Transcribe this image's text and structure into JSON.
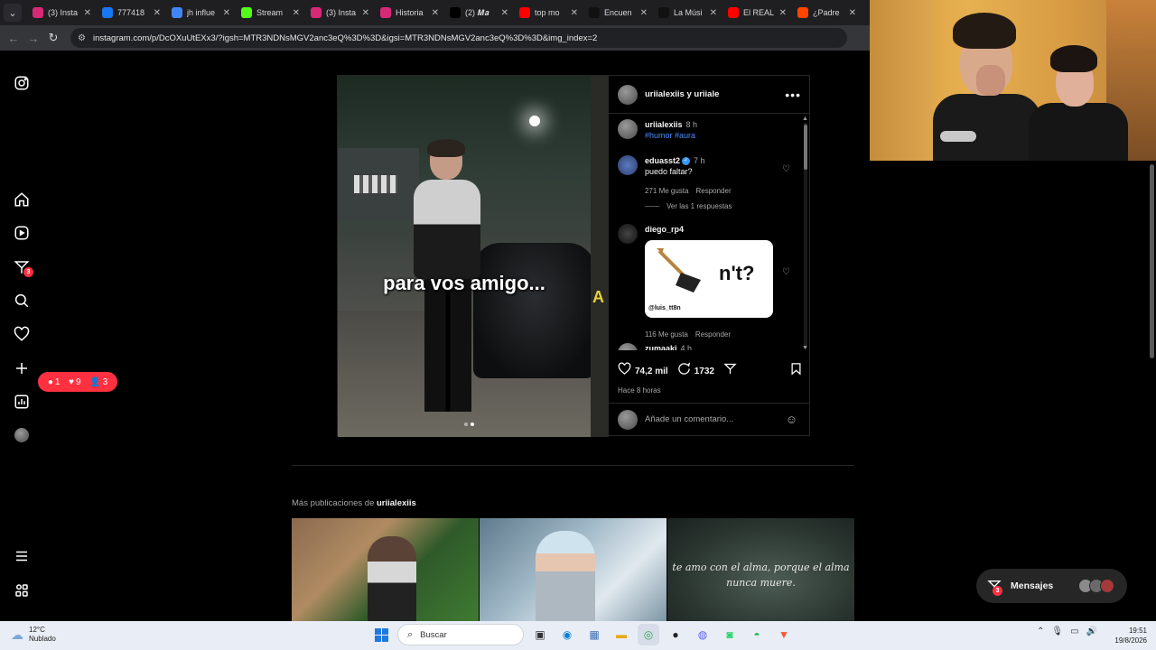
{
  "browser": {
    "tabs": [
      {
        "label": "(3) Insta",
        "icon": "instagram-icon",
        "color": "#d62976"
      },
      {
        "label": "777418",
        "icon": "facebook-icon",
        "color": "#1877f2"
      },
      {
        "label": "jh influe",
        "icon": "google-icon",
        "color": "#4285f4"
      },
      {
        "label": "Stream",
        "icon": "kick-icon",
        "color": "#53fc18"
      },
      {
        "label": "(3) Insta",
        "icon": "instagram-icon",
        "color": "#d62976"
      },
      {
        "label": "Historia",
        "icon": "instagram-icon",
        "color": "#d62976"
      },
      {
        "label": "(2) 𝑴𝒂",
        "icon": "x-icon",
        "color": "#000000"
      },
      {
        "label": "top mo",
        "icon": "youtube-icon",
        "color": "#ff0000"
      },
      {
        "label": "Encuen",
        "icon": "tiktok-icon",
        "color": "#111111"
      },
      {
        "label": "La Músi",
        "icon": "tiktok-icon",
        "color": "#111111"
      },
      {
        "label": "El REAL",
        "icon": "youtube-icon",
        "color": "#ff0000"
      },
      {
        "label": "¿Padre",
        "icon": "reddit-icon",
        "color": "#ff4500"
      }
    ],
    "url": "instagram.com/p/DcOXuUtEXx3/?igsh=MTR3NDNsMGV2anc3eQ%3D%3D&igsi=MTR3NDNsMGV2anc3eQ%3D%3D&img_index=2"
  },
  "nav": {
    "messages_badge": "3",
    "notifications": {
      "comments": "1",
      "likes": "9",
      "follows": "3"
    }
  },
  "post": {
    "header_name": "uriialexiis y uriiale",
    "overlay_text": "para vos amigo...",
    "next_slide_text": "A",
    "caption": {
      "user": "uriialexiis",
      "time": "8 h",
      "tags": "#humor #aura"
    },
    "comments": [
      {
        "user": "eduasst2",
        "time": "7 h",
        "text": "puedo faltar?",
        "likes": "271 Me gusta",
        "reply": "Responder",
        "view_replies": "Ver las 1 respuestas"
      },
      {
        "user": "diego_rp4",
        "sticker_text": "n't?",
        "sticker_handle": "@luis_tt8n",
        "likes": "116 Me gusta",
        "reply": "Responder"
      },
      {
        "user": "zumaaki",
        "time": "4 h"
      }
    ],
    "likes_count": "74,2 mil",
    "comments_count": "1732",
    "posted": "Hace 8 horas",
    "add_comment_placeholder": "Añade un comentario..."
  },
  "more_posts": {
    "prefix": "Más publicaciones de",
    "user": "uriialexiis",
    "quote": "te amo con el alma, porque el alma nunca muere."
  },
  "messages_button": {
    "label": "Mensajes",
    "badge": "3"
  },
  "taskbar": {
    "weather_temp": "12°C",
    "weather_desc": "Nublado",
    "search_placeholder": "Buscar",
    "time": "19:51",
    "date": "19/8/2026"
  }
}
